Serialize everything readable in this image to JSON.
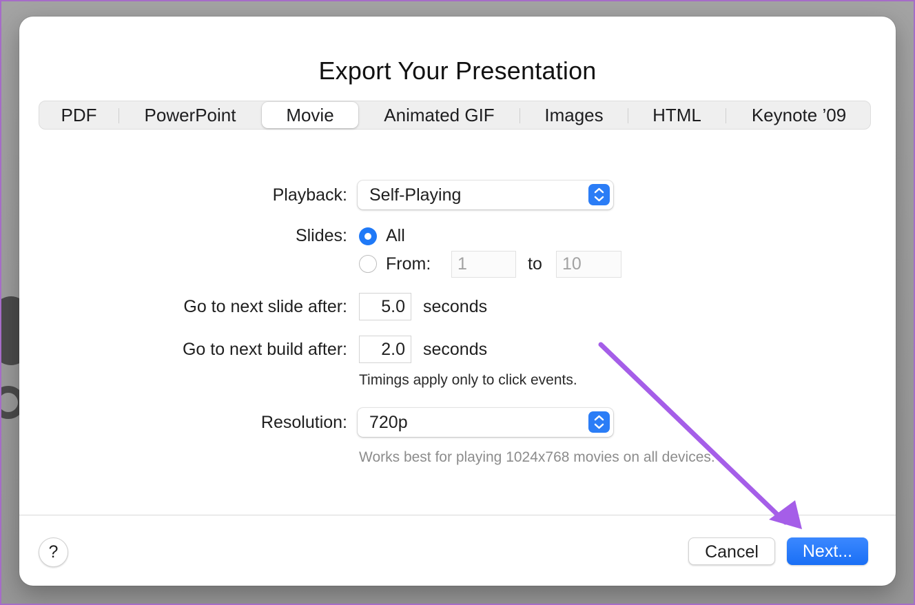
{
  "dialog": {
    "title": "Export Your Presentation",
    "tabs": [
      {
        "label": "PDF"
      },
      {
        "label": "PowerPoint"
      },
      {
        "label": "Movie",
        "active": true
      },
      {
        "label": "Animated GIF"
      },
      {
        "label": "Images"
      },
      {
        "label": "HTML"
      },
      {
        "label": "Keynote ’09"
      }
    ],
    "playback": {
      "label": "Playback:",
      "value": "Self-Playing"
    },
    "slides": {
      "label": "Slides:",
      "option_all": "All",
      "option_from": "From:",
      "from_value": "1",
      "to_label": "to",
      "to_value": "10",
      "selected": "All"
    },
    "next_slide": {
      "label": "Go to next slide after:",
      "value": "5.0",
      "unit": "seconds"
    },
    "next_build": {
      "label": "Go to next build after:",
      "value": "2.0",
      "unit": "seconds"
    },
    "timings_note": "Timings apply only to click events.",
    "resolution": {
      "label": "Resolution:",
      "value": "720p",
      "note": "Works best for playing 1024x768 movies on all devices."
    },
    "footer": {
      "help_label": "?",
      "cancel_label": "Cancel",
      "next_label": "Next..."
    }
  },
  "icons": {
    "select_arrows": "chevron-up-down-icon",
    "annotation": "arrow-annotation-icon"
  },
  "colors": {
    "accent": "#1f79f7",
    "annotation": "#a55ee8"
  }
}
